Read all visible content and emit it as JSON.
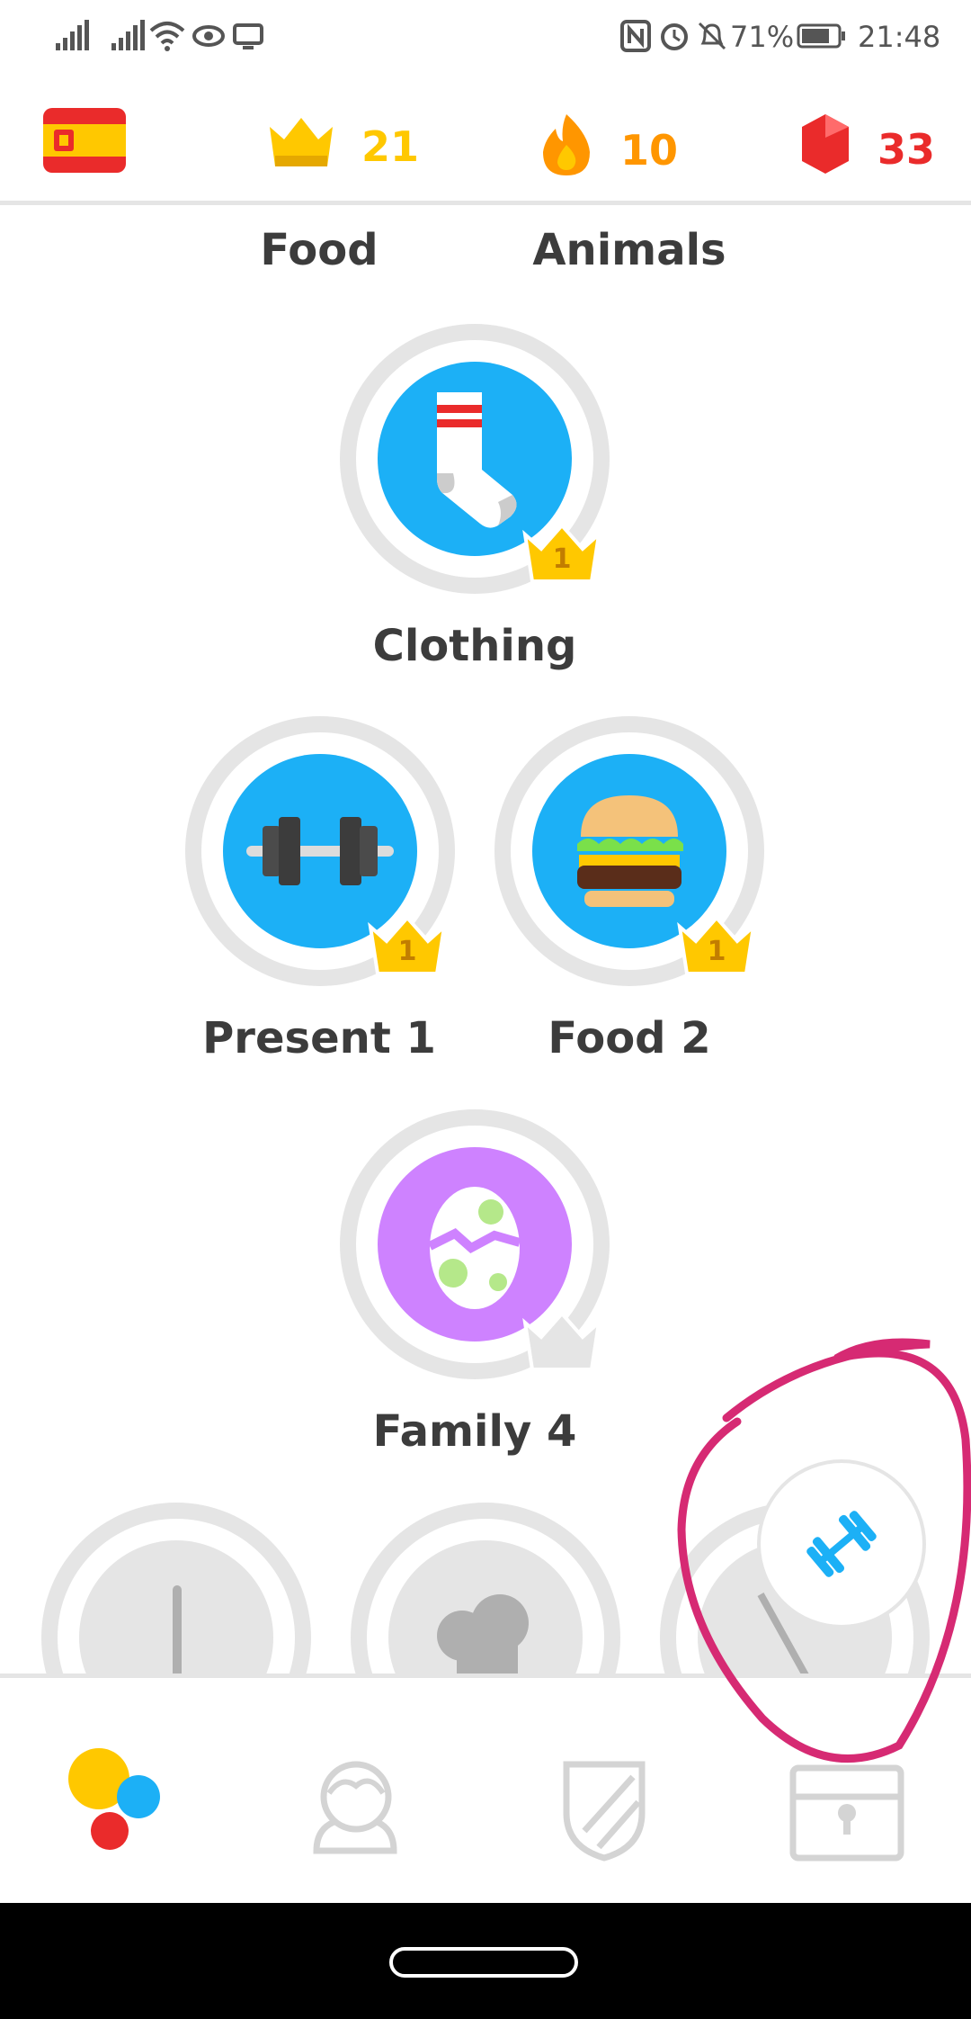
{
  "status_bar": {
    "battery": "71%",
    "time": "21:48",
    "icons": [
      "signal-icon",
      "signal-icon",
      "wifi-icon",
      "eye-icon",
      "screen-icon",
      "nfc-icon",
      "alarm-icon",
      "bell-off-icon",
      "battery-icon"
    ]
  },
  "top_bar": {
    "course_flag": "spain-flag-icon",
    "crowns": "21",
    "streak": "10",
    "gems": "33",
    "colors": {
      "crown": "#ffc800",
      "streak": "#ff9600",
      "gems": "#ea2b2b"
    }
  },
  "skills_header": {
    "left": "Food",
    "right": "Animals"
  },
  "skills": [
    {
      "name": "Clothing",
      "icon": "sock-icon",
      "crown_level": "1",
      "color": "#1cb0f6"
    },
    {
      "name": "Present 1",
      "icon": "dumbbell-icon",
      "crown_level": "1",
      "color": "#1cb0f6"
    },
    {
      "name": "Food 2",
      "icon": "burger-icon",
      "crown_level": "1",
      "color": "#1cb0f6"
    },
    {
      "name": "Family 4",
      "icon": "egg-icon",
      "crown_level": "",
      "color": "#ce82ff"
    }
  ],
  "practice_button": {
    "icon": "dumbbell-icon"
  },
  "bottom_nav": [
    "learn-tab-icon",
    "profile-tab-icon",
    "leagues-tab-icon",
    "shop-tab-icon"
  ],
  "annotation_color": "#d62a73"
}
